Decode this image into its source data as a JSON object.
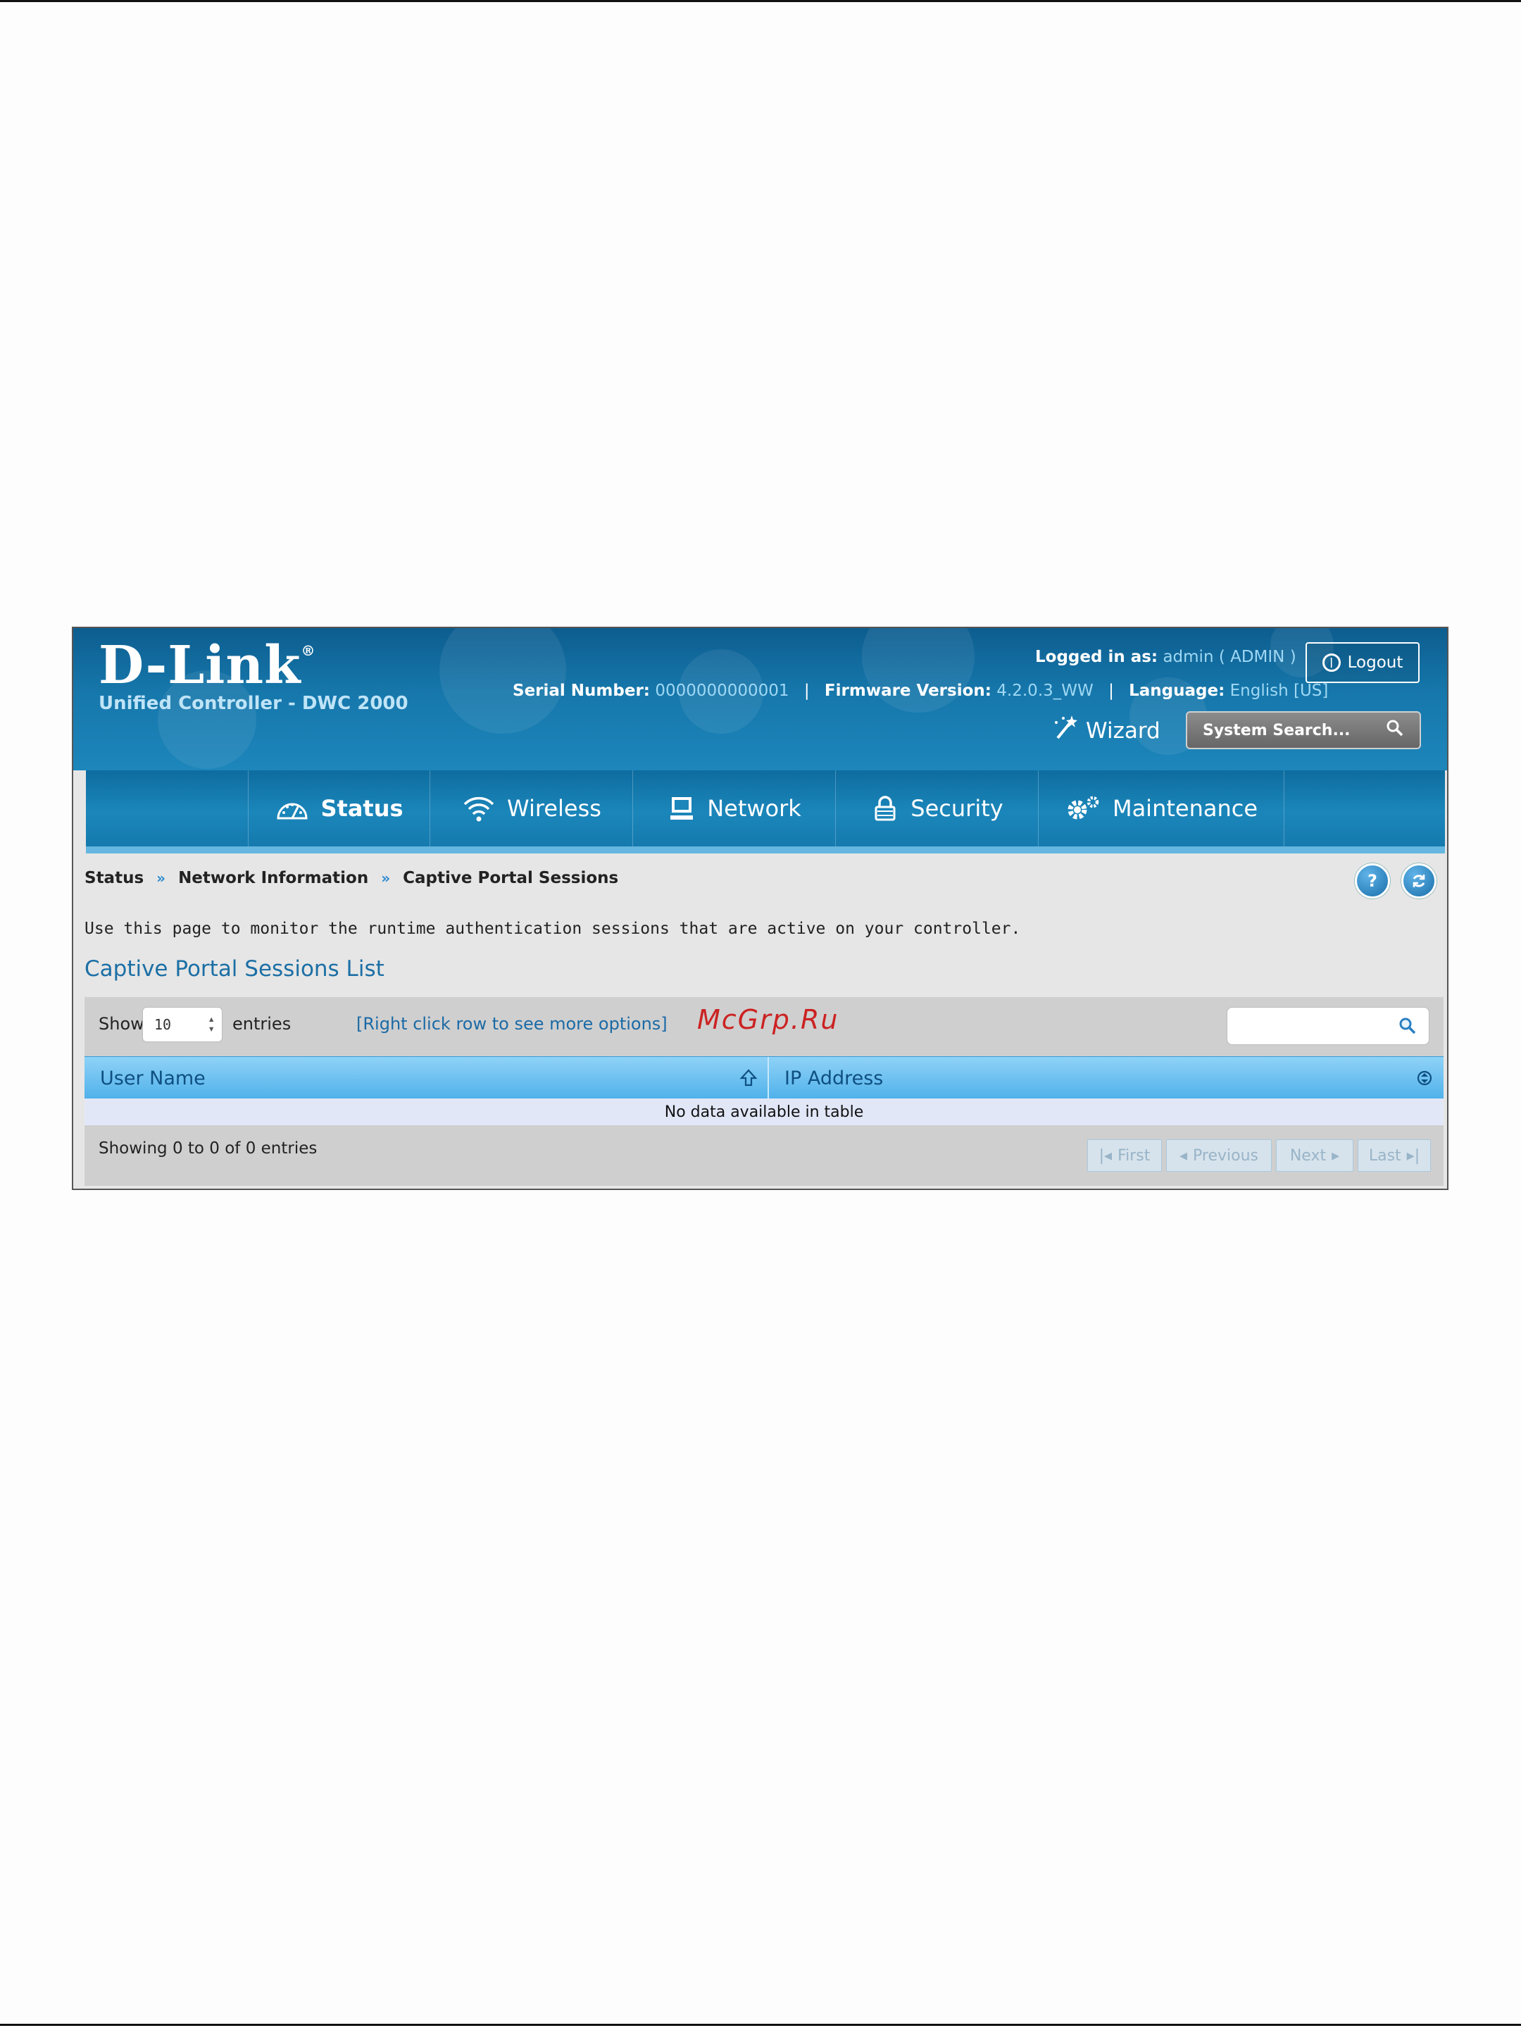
{
  "header": {
    "logo": "D-Link",
    "subtitle": "Unified Controller - DWC 2000",
    "logged_in_label": "Logged in as:",
    "logged_in_value": "admin ( ADMIN )",
    "logout_label": "Logout",
    "serial_label": "Serial Number:",
    "serial_value": "0000000000001",
    "firmware_label": "Firmware Version:",
    "firmware_value": "4.2.0.3_WW",
    "language_label": "Language:",
    "language_value": "English [US]",
    "wizard_label": "Wizard",
    "search_placeholder": "System Search..."
  },
  "nav": {
    "items": [
      {
        "label": "Status",
        "icon": "speedometer-icon",
        "active": true
      },
      {
        "label": "Wireless",
        "icon": "wifi-icon"
      },
      {
        "label": "Network",
        "icon": "computer-icon"
      },
      {
        "label": "Security",
        "icon": "lock-icon"
      },
      {
        "label": "Maintenance",
        "icon": "gears-icon"
      }
    ]
  },
  "breadcrumb": [
    "Status",
    "Network Information",
    "Captive Portal Sessions"
  ],
  "help_icons": [
    "help-icon",
    "refresh-icon"
  ],
  "description": "Use this page to monitor the runtime authentication sessions that are active on your controller.",
  "section_title": "Captive Portal Sessions List",
  "table": {
    "show_label": "Show",
    "entries_value": "10",
    "entries_label": "entries",
    "right_click_hint": "[Right click row to see more options]",
    "columns": [
      "User Name",
      "IP Address"
    ],
    "empty_message": "No data available in table",
    "showing_text": "Showing 0 to 0 of 0 entries",
    "pager": [
      "First",
      "Previous",
      "Next",
      "Last"
    ]
  },
  "watermark": "McGrp.Ru",
  "colors": {
    "header_blue": "#1677ab",
    "accent_blue": "#1c6fa5",
    "table_header": "#4fb1ea",
    "watermark_red": "#cc2222"
  }
}
